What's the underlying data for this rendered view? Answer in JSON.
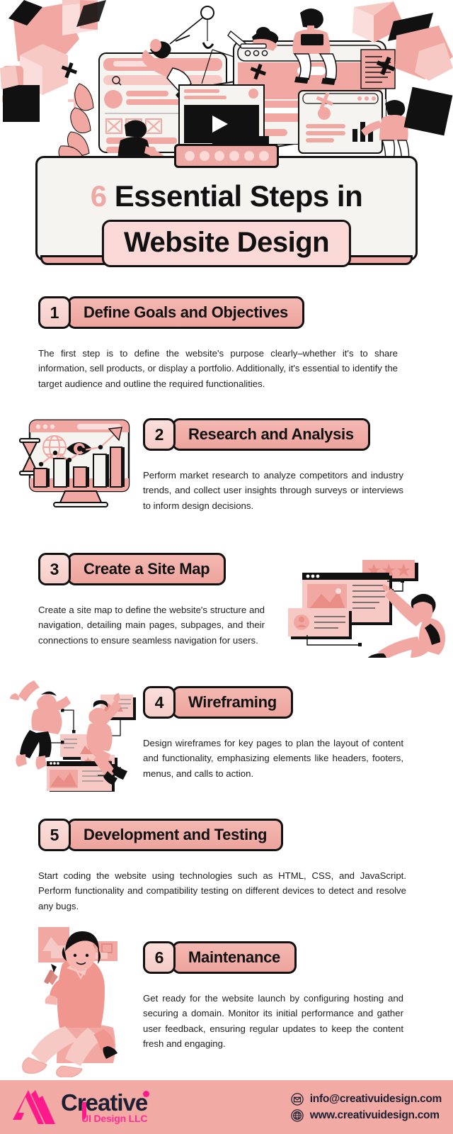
{
  "header": {
    "number": "6",
    "title_line1": "Essential Steps in",
    "title_line2": "Website Design",
    "dots_count": 6
  },
  "colors": {
    "accent_pink": "#efa9a4",
    "light_pink": "#fbd9d6",
    "badge_pink": "#f4b8b2",
    "card_bg": "#f6f4f0",
    "outline": "#111111",
    "footer_bg": "#f2aaa5",
    "logo_magenta": "#ff2e95",
    "logo_navy": "#1c2033"
  },
  "steps": [
    {
      "number": "1",
      "title": "Define Goals and Objectives",
      "body": "The first step is to define the website's purpose clearly–whether it's to share information, sell products, or display a portfolio. Additionally, it's essential to identify the target audience and outline the required functionalities.",
      "illustration": null
    },
    {
      "number": "2",
      "title": "Research and Analysis",
      "body": "Perform market research to analyze competitors and industry trends, and collect user insights through surveys or interviews to inform design decisions.",
      "illustration": "monitor-analytics-chart-illustration"
    },
    {
      "number": "3",
      "title": "Create a Site Map",
      "body": "Create a site map to define the website's structure and navigation, detailing main pages, subpages, and their connections to ensure seamless navigation for users.",
      "illustration": "person-sitemap-browser-illustration"
    },
    {
      "number": "4",
      "title": "Wireframing",
      "body": "Design wireframes for key pages to plan the layout of content and functionality, emphasizing elements like headers, footers, menus, and calls to action.",
      "illustration": "people-wireframe-cards-illustration"
    },
    {
      "number": "5",
      "title": "Development and Testing",
      "body": "Start coding the website using technologies such as HTML, CSS, and JavaScript. Perform functionality and compatibility testing on different devices to detect and resolve any bugs.",
      "illustration": null
    },
    {
      "number": "6",
      "title": "Maintenance",
      "body": "Get ready for the website launch by configuring hosting and securing a domain. Monitor its initial performance and gather user feedback, ensuring regular updates to keep the content fresh and engaging.",
      "illustration": "seated-person-with-pencil-illustration"
    }
  ],
  "footer": {
    "logo_name": "Creative",
    "logo_tagline": "UI Design LLC",
    "email": "info@creativuidesign.com",
    "website": "www.creativuidesign.com",
    "email_icon": "envelope-icon",
    "website_icon": "globe-icon"
  }
}
